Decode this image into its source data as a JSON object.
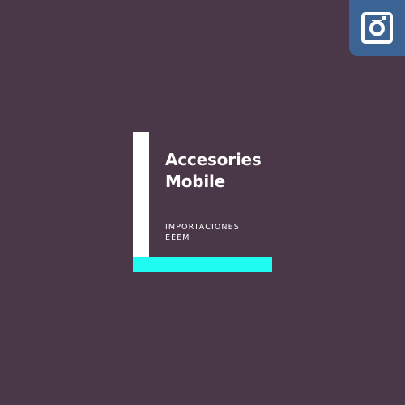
{
  "colors": {
    "background": "#4a3748",
    "accent": "#1ffbf0",
    "instagram_button": "#3b6494",
    "text": "#ffffff"
  },
  "social": {
    "icon": "instagram-icon"
  },
  "brand": {
    "title_line1": "Accesories",
    "title_line2": "Mobile",
    "subtitle_line1": "IMPORTACIONES",
    "subtitle_line2": "EEEM"
  }
}
